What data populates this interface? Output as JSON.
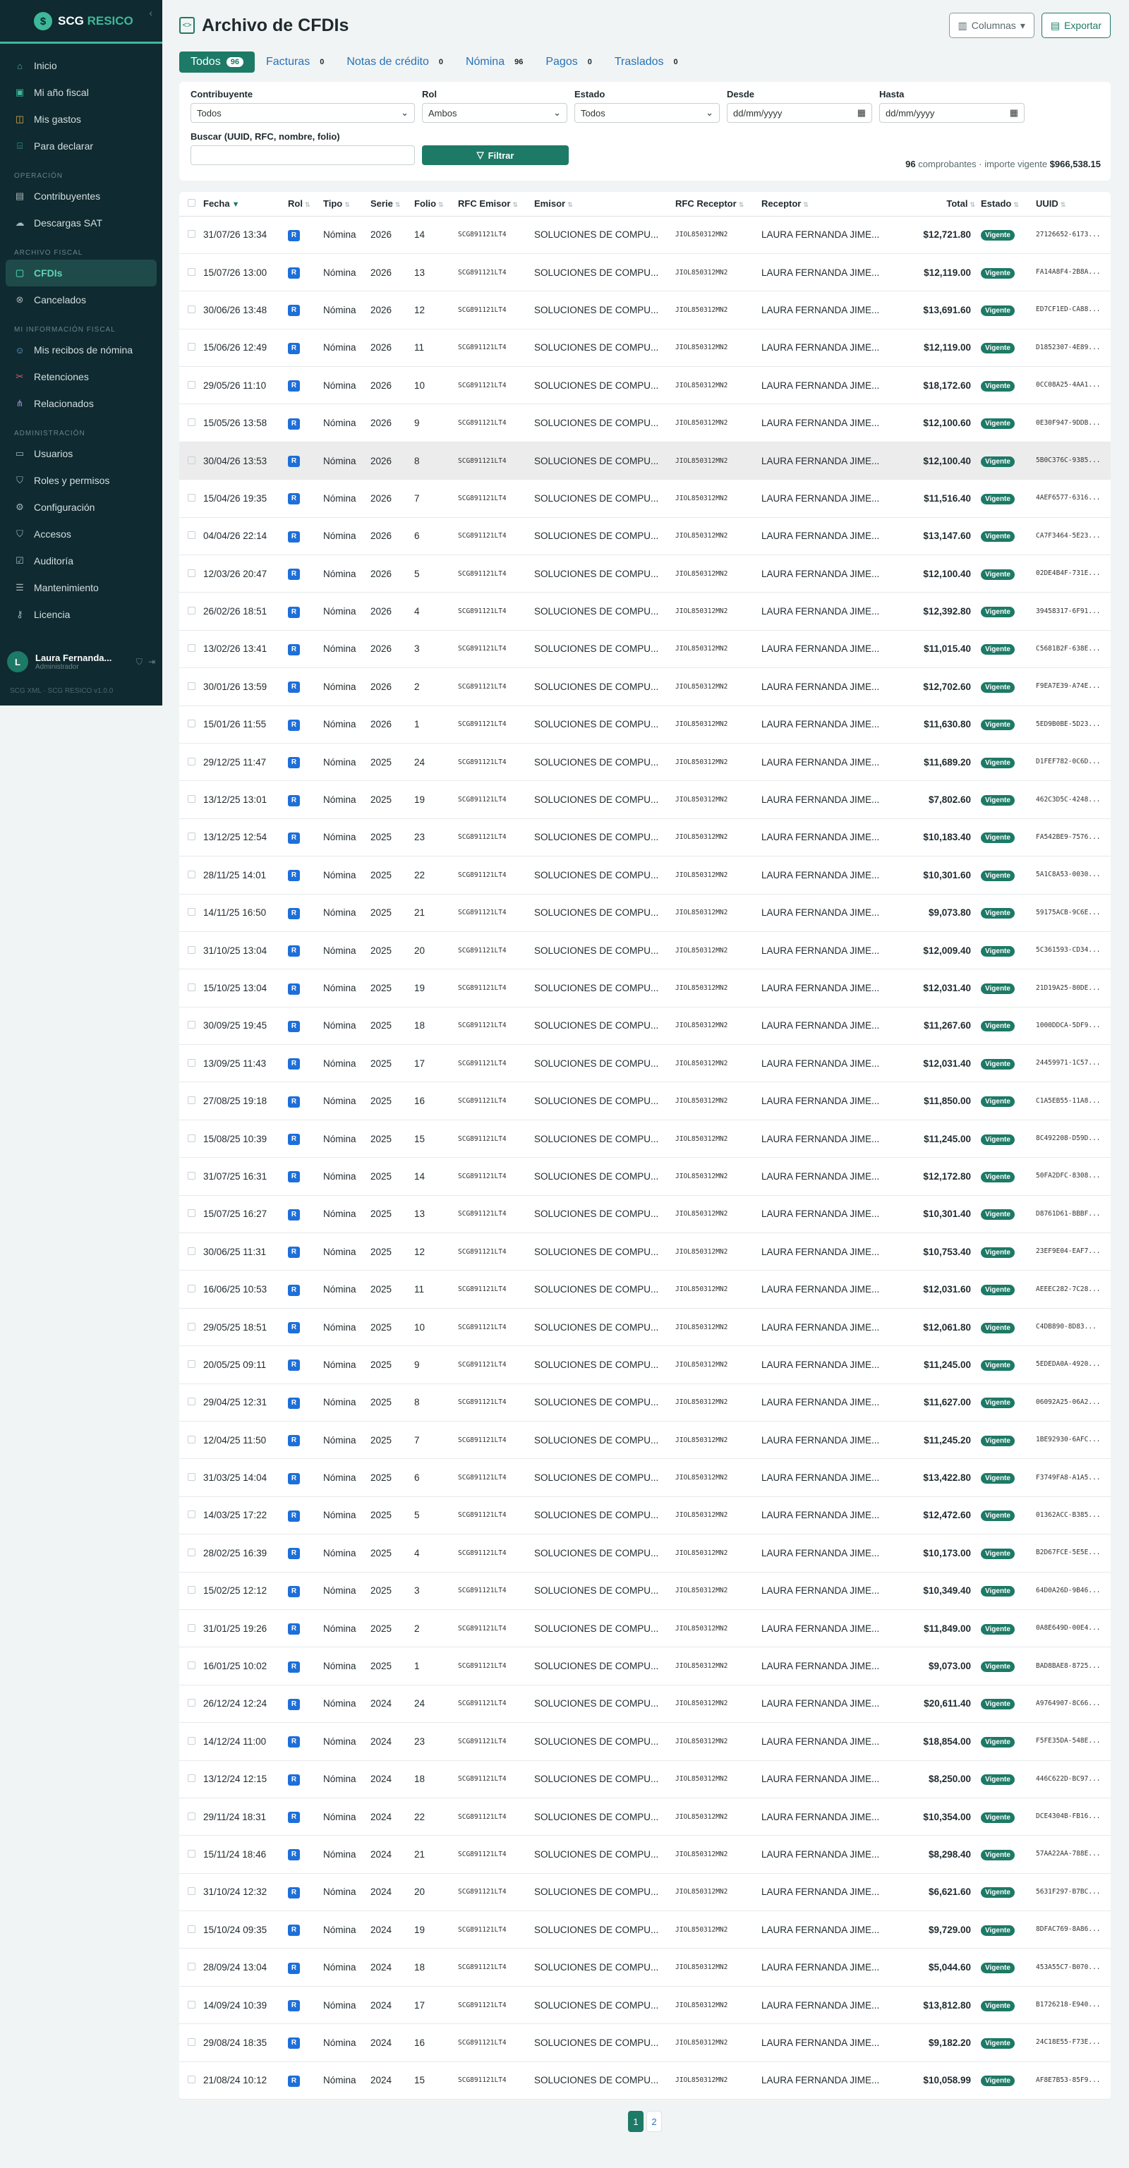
{
  "sidebar": {
    "brand": {
      "prefix": "SCG",
      "suffix": "RESICO"
    },
    "collapse_icon": "‹",
    "items_top": [
      {
        "label": "Inicio",
        "icon": "home-icon",
        "glyph": "⌂",
        "color": "teal"
      },
      {
        "label": "Mi año fiscal",
        "icon": "ledger-icon",
        "glyph": "▣",
        "color": "teal"
      },
      {
        "label": "Mis gastos",
        "icon": "wallet-icon",
        "glyph": "◫",
        "color": "gold"
      },
      {
        "label": "Para declarar",
        "icon": "bank-icon",
        "glyph": "⌸",
        "color": "teal"
      }
    ],
    "sections": [
      {
        "title": "OPERACIÓN",
        "items": [
          {
            "label": "Contribuyentes",
            "icon": "building-icon",
            "glyph": "▤",
            "color": "gray"
          },
          {
            "label": "Descargas SAT",
            "icon": "cloud-download-icon",
            "glyph": "☁",
            "color": "gray"
          }
        ]
      },
      {
        "title": "ARCHIVO FISCAL",
        "items": [
          {
            "label": "CFDIs",
            "icon": "document-icon",
            "glyph": "▢",
            "color": "teal",
            "active": true
          },
          {
            "label": "Cancelados",
            "icon": "cancel-circle-icon",
            "glyph": "⊗",
            "color": "gray"
          }
        ]
      },
      {
        "title": "MI INFORMACIÓN FISCAL",
        "items": [
          {
            "label": "Mis recibos de nómina",
            "icon": "people-icon",
            "glyph": "☺",
            "color": "blue"
          },
          {
            "label": "Retenciones",
            "icon": "scissors-icon",
            "glyph": "✂",
            "color": "red"
          },
          {
            "label": "Relacionados",
            "icon": "network-icon",
            "glyph": "⋔",
            "color": "purple"
          }
        ]
      },
      {
        "title": "ADMINISTRACIÓN",
        "items": [
          {
            "label": "Usuarios",
            "icon": "id-card-icon",
            "glyph": "▭",
            "color": "gray"
          },
          {
            "label": "Roles y permisos",
            "icon": "shield-icon",
            "glyph": "⛉",
            "color": "gray"
          },
          {
            "label": "Configuración",
            "icon": "gear-icon",
            "glyph": "⚙",
            "color": "gray"
          },
          {
            "label": "Accesos",
            "icon": "shield-check-icon",
            "glyph": "⛉",
            "color": "gray"
          },
          {
            "label": "Auditoría",
            "icon": "checklist-icon",
            "glyph": "☑",
            "color": "gray"
          },
          {
            "label": "Mantenimiento",
            "icon": "server-icon",
            "glyph": "☰",
            "color": "gray"
          },
          {
            "label": "Licencia",
            "icon": "key-icon",
            "glyph": "⚷",
            "color": "gray"
          }
        ]
      }
    ],
    "user": {
      "initial": "L",
      "name": "Laura Fernanda...",
      "role": "Administrador"
    },
    "version": "SCG XML · SCG RESICO v1.0.0"
  },
  "header": {
    "title": "Archivo de CFDIs",
    "columns_button": "Columnas",
    "export_button": "Exportar"
  },
  "tabs": [
    {
      "label": "Todos",
      "count": "96",
      "active": true
    },
    {
      "label": "Facturas",
      "count": "0"
    },
    {
      "label": "Notas de crédito",
      "count": "0"
    },
    {
      "label": "Nómina",
      "count": "96"
    },
    {
      "label": "Pagos",
      "count": "0"
    },
    {
      "label": "Traslados",
      "count": "0"
    }
  ],
  "filters": {
    "contribuyente": {
      "label": "Contribuyente",
      "value": "Todos"
    },
    "rol": {
      "label": "Rol",
      "value": "Ambos"
    },
    "estado": {
      "label": "Estado",
      "value": "Todos"
    },
    "desde": {
      "label": "Desde",
      "value": "dd/mm/yyyy"
    },
    "hasta": {
      "label": "Hasta",
      "value": "dd/mm/yyyy"
    },
    "search": {
      "label": "Buscar (UUID, RFC, nombre, folio)",
      "placeholder": ""
    },
    "filter_button": "Filtrar",
    "summary_count": "96",
    "summary_text": "comprobantes · importe vigente",
    "summary_amount": "$966,538.15"
  },
  "table": {
    "columns": [
      "Fecha",
      "Rol",
      "Tipo",
      "Serie",
      "Folio",
      "RFC Emisor",
      "Emisor",
      "RFC Receptor",
      "Receptor",
      "Total",
      "Estado",
      "UUID"
    ],
    "common": {
      "rol": "R",
      "tipo": "Nómina",
      "rfc_emisor": "SCG891121LT4",
      "emisor": "SOLUCIONES DE COMPU...",
      "rfc_receptor": "JIOL850312MN2",
      "receptor": "LAURA FERNANDA JIME...",
      "estado": "Vigente"
    },
    "rows": [
      {
        "fecha": "31/07/26 13:34",
        "serie": "2026",
        "folio": "14",
        "total": "$12,721.80",
        "uuid": "27126652-6173..."
      },
      {
        "fecha": "15/07/26 13:00",
        "serie": "2026",
        "folio": "13",
        "total": "$12,119.00",
        "uuid": "FA14A8F4-2B8A..."
      },
      {
        "fecha": "30/06/26 13:48",
        "serie": "2026",
        "folio": "12",
        "total": "$13,691.60",
        "uuid": "ED7CF1ED-CA88..."
      },
      {
        "fecha": "15/06/26 12:49",
        "serie": "2026",
        "folio": "11",
        "total": "$12,119.00",
        "uuid": "D1852307-4E89..."
      },
      {
        "fecha": "29/05/26 11:10",
        "serie": "2026",
        "folio": "10",
        "total": "$18,172.60",
        "uuid": "0CC08A25-4AA1..."
      },
      {
        "fecha": "15/05/26 13:58",
        "serie": "2026",
        "folio": "9",
        "total": "$12,100.60",
        "uuid": "0E30F947-9DDB..."
      },
      {
        "fecha": "30/04/26 13:53",
        "serie": "2026",
        "folio": "8",
        "total": "$12,100.40",
        "uuid": "5B0C376C-9385...",
        "highlight": true
      },
      {
        "fecha": "15/04/26 19:35",
        "serie": "2026",
        "folio": "7",
        "total": "$11,516.40",
        "uuid": "4AEF6577-6316..."
      },
      {
        "fecha": "04/04/26 22:14",
        "serie": "2026",
        "folio": "6",
        "total": "$13,147.60",
        "uuid": "CA7F3464-5E23..."
      },
      {
        "fecha": "12/03/26 20:47",
        "serie": "2026",
        "folio": "5",
        "total": "$12,100.40",
        "uuid": "02DE4B4F-731E..."
      },
      {
        "fecha": "26/02/26 18:51",
        "serie": "2026",
        "folio": "4",
        "total": "$12,392.80",
        "uuid": "39458317-6F91..."
      },
      {
        "fecha": "13/02/26 13:41",
        "serie": "2026",
        "folio": "3",
        "total": "$11,015.40",
        "uuid": "C5681B2F-638E..."
      },
      {
        "fecha": "30/01/26 13:59",
        "serie": "2026",
        "folio": "2",
        "total": "$12,702.60",
        "uuid": "F9EA7E39-A74E..."
      },
      {
        "fecha": "15/01/26 11:55",
        "serie": "2026",
        "folio": "1",
        "total": "$11,630.80",
        "uuid": "5ED9B0BE-5D23..."
      },
      {
        "fecha": "29/12/25 11:47",
        "serie": "2025",
        "folio": "24",
        "total": "$11,689.20",
        "uuid": "D1FEF782-0C6D..."
      },
      {
        "fecha": "13/12/25 13:01",
        "serie": "2025",
        "folio": "19",
        "total": "$7,802.60",
        "uuid": "462C3D5C-4248..."
      },
      {
        "fecha": "13/12/25 12:54",
        "serie": "2025",
        "folio": "23",
        "total": "$10,183.40",
        "uuid": "FA542BE9-7576..."
      },
      {
        "fecha": "28/11/25 14:01",
        "serie": "2025",
        "folio": "22",
        "total": "$10,301.60",
        "uuid": "5A1C8A53-0030..."
      },
      {
        "fecha": "14/11/25 16:50",
        "serie": "2025",
        "folio": "21",
        "total": "$9,073.80",
        "uuid": "59175ACB-9C6E..."
      },
      {
        "fecha": "31/10/25 13:04",
        "serie": "2025",
        "folio": "20",
        "total": "$12,009.40",
        "uuid": "5C361593-CD34..."
      },
      {
        "fecha": "15/10/25 13:04",
        "serie": "2025",
        "folio": "19",
        "total": "$12,031.40",
        "uuid": "21D19A25-80DE..."
      },
      {
        "fecha": "30/09/25 19:45",
        "serie": "2025",
        "folio": "18",
        "total": "$11,267.60",
        "uuid": "1000DDCA-5DF9..."
      },
      {
        "fecha": "13/09/25 11:43",
        "serie": "2025",
        "folio": "17",
        "total": "$12,031.40",
        "uuid": "24459971-1C57..."
      },
      {
        "fecha": "27/08/25 19:18",
        "serie": "2025",
        "folio": "16",
        "total": "$11,850.00",
        "uuid": "C1A5EB55-11A8..."
      },
      {
        "fecha": "15/08/25 10:39",
        "serie": "2025",
        "folio": "15",
        "total": "$11,245.00",
        "uuid": "8C492208-D59D..."
      },
      {
        "fecha": "31/07/25 16:31",
        "serie": "2025",
        "folio": "14",
        "total": "$12,172.80",
        "uuid": "50FA2DFC-8308..."
      },
      {
        "fecha": "15/07/25 16:27",
        "serie": "2025",
        "folio": "13",
        "total": "$10,301.40",
        "uuid": "D8761D61-BBBF..."
      },
      {
        "fecha": "30/06/25 11:31",
        "serie": "2025",
        "folio": "12",
        "total": "$10,753.40",
        "uuid": "23EF9E04-EAF7..."
      },
      {
        "fecha": "16/06/25 10:53",
        "serie": "2025",
        "folio": "11",
        "total": "$12,031.60",
        "uuid": "AEEEC282-7C28..."
      },
      {
        "fecha": "29/05/25 18:51",
        "serie": "2025",
        "folio": "10",
        "total": "$12,061.80",
        "uuid": "C4DB890-8D83..."
      },
      {
        "fecha": "20/05/25 09:11",
        "serie": "2025",
        "folio": "9",
        "total": "$11,245.00",
        "uuid": "5EDEDA0A-4920..."
      },
      {
        "fecha": "29/04/25 12:31",
        "serie": "2025",
        "folio": "8",
        "total": "$11,627.00",
        "uuid": "06092A25-06A2..."
      },
      {
        "fecha": "12/04/25 11:50",
        "serie": "2025",
        "folio": "7",
        "total": "$11,245.20",
        "uuid": "1BE92930-6AFC..."
      },
      {
        "fecha": "31/03/25 14:04",
        "serie": "2025",
        "folio": "6",
        "total": "$13,422.80",
        "uuid": "F3749FA8-A1A5..."
      },
      {
        "fecha": "14/03/25 17:22",
        "serie": "2025",
        "folio": "5",
        "total": "$12,472.60",
        "uuid": "01362ACC-B385..."
      },
      {
        "fecha": "28/02/25 16:39",
        "serie": "2025",
        "folio": "4",
        "total": "$10,173.00",
        "uuid": "B2D67FCE-5E5E..."
      },
      {
        "fecha": "15/02/25 12:12",
        "serie": "2025",
        "folio": "3",
        "total": "$10,349.40",
        "uuid": "64D0A26D-9B46..."
      },
      {
        "fecha": "31/01/25 19:26",
        "serie": "2025",
        "folio": "2",
        "total": "$11,849.00",
        "uuid": "0A8E649D-00E4..."
      },
      {
        "fecha": "16/01/25 10:02",
        "serie": "2025",
        "folio": "1",
        "total": "$9,073.00",
        "uuid": "BAD8BAE8-8725..."
      },
      {
        "fecha": "26/12/24 12:24",
        "serie": "2024",
        "folio": "24",
        "total": "$20,611.40",
        "uuid": "A9764907-8C66..."
      },
      {
        "fecha": "14/12/24 11:00",
        "serie": "2024",
        "folio": "23",
        "total": "$18,854.00",
        "uuid": "F5FE35DA-548E..."
      },
      {
        "fecha": "13/12/24 12:15",
        "serie": "2024",
        "folio": "18",
        "total": "$8,250.00",
        "uuid": "446C622D-BC97..."
      },
      {
        "fecha": "29/11/24 18:31",
        "serie": "2024",
        "folio": "22",
        "total": "$10,354.00",
        "uuid": "DCE4304B-FB16..."
      },
      {
        "fecha": "15/11/24 18:46",
        "serie": "2024",
        "folio": "21",
        "total": "$8,298.40",
        "uuid": "57AA22AA-788E..."
      },
      {
        "fecha": "31/10/24 12:32",
        "serie": "2024",
        "folio": "20",
        "total": "$6,621.60",
        "uuid": "5631F297-B7BC..."
      },
      {
        "fecha": "15/10/24 09:35",
        "serie": "2024",
        "folio": "19",
        "total": "$9,729.00",
        "uuid": "8DFAC769-8A86..."
      },
      {
        "fecha": "28/09/24 13:04",
        "serie": "2024",
        "folio": "18",
        "total": "$5,044.60",
        "uuid": "453A55C7-B070..."
      },
      {
        "fecha": "14/09/24 10:39",
        "serie": "2024",
        "folio": "17",
        "total": "$13,812.80",
        "uuid": "B1726218-E940..."
      },
      {
        "fecha": "29/08/24 18:35",
        "serie": "2024",
        "folio": "16",
        "total": "$9,182.20",
        "uuid": "24C18E55-F73E..."
      },
      {
        "fecha": "21/08/24 10:12",
        "serie": "2024",
        "folio": "15",
        "total": "$10,058.99",
        "uuid": "AF8E7B53-85F9..."
      }
    ]
  },
  "pagination": {
    "pages": [
      "1",
      "2"
    ],
    "current": "1"
  }
}
